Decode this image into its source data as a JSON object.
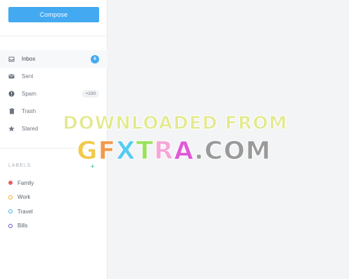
{
  "compose": {
    "label": "Compose"
  },
  "nav": {
    "items": [
      {
        "label": "Inbox",
        "icon": "inbox-icon",
        "badge": "6",
        "active": true
      },
      {
        "label": "Sent",
        "icon": "envelope-icon",
        "badge": null
      },
      {
        "label": "Spam",
        "icon": "alert-icon",
        "badge": "+100"
      },
      {
        "label": "Trash",
        "icon": "trash-icon",
        "badge": null
      },
      {
        "label": "Stared",
        "icon": "star-icon",
        "badge": null
      }
    ]
  },
  "labels": {
    "header": "LABELS",
    "add_symbol": "+",
    "items": [
      {
        "label": "Family",
        "color": "#ef5b5b",
        "filled": true
      },
      {
        "label": "Work",
        "color": "#f0a92a",
        "filled": false
      },
      {
        "label": "Travel",
        "color": "#3fb6e8",
        "filled": false
      },
      {
        "label": "Bills",
        "color": "#6a4fc8",
        "filled": false
      }
    ]
  },
  "watermark": {
    "line1": "DOWNLOADED FROM",
    "line2_parts": [
      {
        "text": "G",
        "color": "#f2c94c"
      },
      {
        "text": "F",
        "color": "#f2994a"
      },
      {
        "text": "X",
        "color": "#56ccf2"
      },
      {
        "text": "T",
        "color": "#9be15d"
      },
      {
        "text": "R",
        "color": "#f6a6d8"
      },
      {
        "text": "A",
        "color": "#e05ad6"
      },
      {
        "text": ".COM",
        "color": "#9a9a9a"
      }
    ]
  },
  "colors": {
    "accent": "#43a9f1",
    "add_label": "#43c0a7",
    "background": "#f3f4f6"
  }
}
